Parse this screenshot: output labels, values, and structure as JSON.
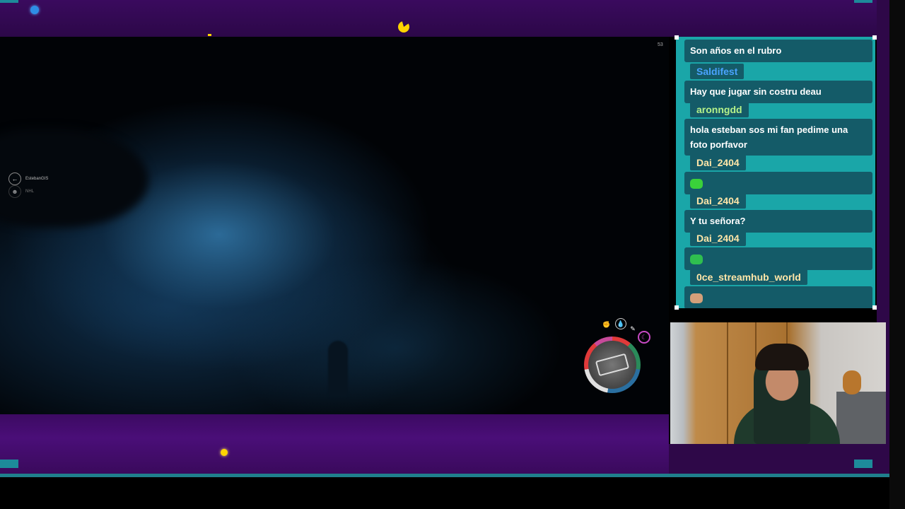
{
  "overlay": {
    "theme": "pacman",
    "colors": {
      "frame": "#3a0a5e",
      "chat_bg": "#1aa6a8",
      "chat_bubble": "#145b68",
      "accent_line": "#1f7f8c",
      "pellet": "#ffd400"
    }
  },
  "game": {
    "fps_counter": "53",
    "players": [
      {
        "name": "EstebanGIS",
        "icon": "arrow-icon"
      },
      {
        "name": "NHL",
        "icon": "avatar-icon"
      }
    ],
    "hud": {
      "icons": [
        "fist-icon",
        "water-drop-icon",
        "wrench-icon",
        "moon-icon"
      ],
      "weapon_icon": "weapon-icon"
    }
  },
  "chat": {
    "messages": [
      {
        "user": "",
        "user_color": "#ffffff",
        "text": "Son años en el rubro"
      },
      {
        "user": "Saldifest",
        "user_color": "#4aa3ff",
        "text": "Hay que jugar sin costru deau"
      },
      {
        "user": "aronngdd",
        "user_color": "#b6f28a",
        "text": "hola esteban sos mi fan pedime una foto porfavor"
      },
      {
        "user": "Dai_2404",
        "user_color": "#ffe6a8",
        "text": "",
        "emote": "green-slime-emote",
        "emote_color": "#3ad13a"
      },
      {
        "user": "Dai_2404",
        "user_color": "#ffe6a8",
        "text": "Y tu señora?"
      },
      {
        "user": "Dai_2404",
        "user_color": "#ffe6a8",
        "text": "",
        "emote": "green-face-emote",
        "emote_color": "#2fbf4f"
      },
      {
        "user": "0ce_streamhub_world",
        "user_color": "#ffe6a8",
        "text": "",
        "emote": "cat-emote",
        "emote_color": "#d4a07a"
      }
    ]
  },
  "webcam": {
    "label": "webcam-feed"
  }
}
